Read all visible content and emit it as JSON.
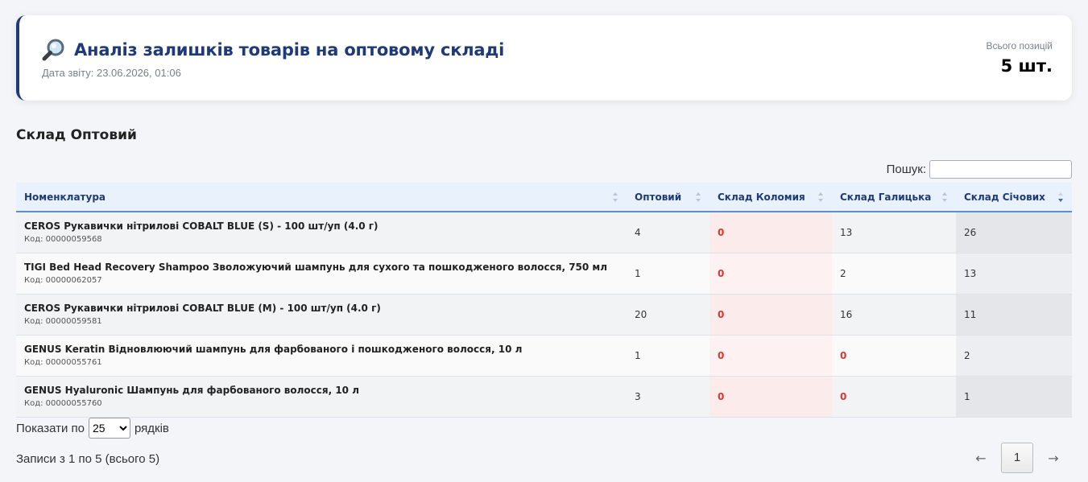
{
  "header": {
    "title": "Аналіз залишків товарів на оптовому складі",
    "date_label": "Дата звіту: 23.06.2026, 01:06",
    "total_label": "Всього позицій",
    "total_value": "5 шт.",
    "icon": "magnifier-icon",
    "accent_color": "#1f3a78"
  },
  "section": {
    "title": "Склад Оптовий"
  },
  "search": {
    "label": "Пошук:",
    "value": "",
    "placeholder": ""
  },
  "table": {
    "columns": [
      "Номенклатура",
      "Оптовий",
      "Склад Коломия",
      "Склад Галицька",
      "Склад Січових"
    ],
    "sorted_column": "Склад Січових",
    "sort_direction": "desc",
    "rows": [
      {
        "name": "CEROS Рукавички нітрилові COBALT BLUE (S) - 100 шт/уп (4.0 г)",
        "code": "Код: 00000059568",
        "optovyi": "4",
        "kolomyia": "0",
        "halytska": "13",
        "sichovykh": "26"
      },
      {
        "name": "TIGI Bed Head Recovery Shampoo Зволожуючий шампунь для сухого та пошкодженого волосся, 750 мл",
        "code": "Код: 00000062057",
        "optovyi": "1",
        "kolomyia": "0",
        "halytska": "2",
        "sichovykh": "13"
      },
      {
        "name": "CEROS Рукавички нітрилові COBALT BLUE (M) - 100 шт/уп (4.0 г)",
        "code": "Код: 00000059581",
        "optovyi": "20",
        "kolomyia": "0",
        "halytska": "16",
        "sichovykh": "11"
      },
      {
        "name": "GENUS Keratin Відновлюючий шампунь для фарбованого і пошкодженого волосся, 10 л",
        "code": "Код: 00000055761",
        "optovyi": "1",
        "kolomyia": "0",
        "halytska": "0",
        "sichovykh": "2"
      },
      {
        "name": "GENUS Hyaluronic Шампунь для фарбованого волосся, 10 л",
        "code": "Код: 00000055760",
        "optovyi": "3",
        "kolomyia": "0",
        "halytska": "0",
        "sichovykh": "1"
      }
    ],
    "zero_color": "#d43a2f"
  },
  "length": {
    "prefix": "Показати по",
    "selected": "25",
    "suffix": "рядків"
  },
  "info": "Записи з 1 по 5 (всього 5)",
  "pagination": {
    "prev": "←",
    "current": "1",
    "next": "→"
  }
}
